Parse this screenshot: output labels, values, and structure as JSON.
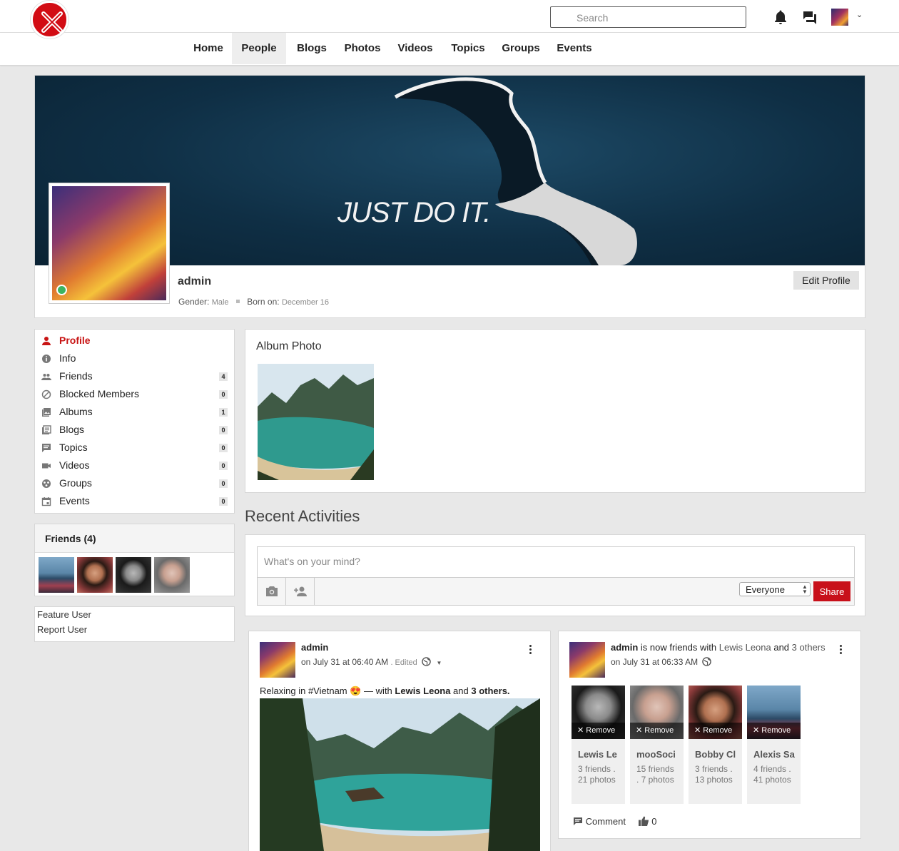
{
  "header": {
    "search_placeholder": "Search"
  },
  "nav": {
    "items": [
      {
        "label": "Home"
      },
      {
        "label": "People",
        "active": true
      },
      {
        "label": "Blogs"
      },
      {
        "label": "Photos"
      },
      {
        "label": "Videos"
      },
      {
        "label": "Topics"
      },
      {
        "label": "Groups"
      },
      {
        "label": "Events"
      }
    ]
  },
  "profile": {
    "cover_text": "JUST DO IT.",
    "name": "admin",
    "gender_label": "Gender:",
    "gender_value": "Male",
    "born_label": "Born on:",
    "born_value": "December 16",
    "edit_button": "Edit Profile",
    "online": true
  },
  "sidebar": {
    "items": [
      {
        "label": "Profile",
        "icon": "person-icon",
        "active": true
      },
      {
        "label": "Info",
        "icon": "info-icon",
        "count": ""
      },
      {
        "label": "Friends",
        "icon": "people-icon",
        "count": "4"
      },
      {
        "label": "Blocked Members",
        "icon": "block-icon",
        "count": "0"
      },
      {
        "label": "Albums",
        "icon": "photo-library-icon",
        "count": "1"
      },
      {
        "label": "Blogs",
        "icon": "blog-icon",
        "count": "0"
      },
      {
        "label": "Topics",
        "icon": "topic-icon",
        "count": "0"
      },
      {
        "label": "Videos",
        "icon": "video-icon",
        "count": "0"
      },
      {
        "label": "Groups",
        "icon": "group-icon",
        "count": "0"
      },
      {
        "label": "Events",
        "icon": "calendar-icon",
        "count": "0"
      }
    ]
  },
  "friends_widget": {
    "title": "Friends (4)"
  },
  "user_actions": {
    "feature": "Feature User",
    "report": "Report User"
  },
  "album": {
    "title": "Album Photo"
  },
  "recent": {
    "title": "Recent Activities"
  },
  "composer": {
    "placeholder": "What's on your mind?",
    "privacy": "Everyone",
    "share": "Share"
  },
  "posts": [
    {
      "author": "admin",
      "time": "on July 31 at 06:40 AM",
      "edited": ". Edited",
      "text_prefix": "Relaxing in ",
      "hashtag": "#Vietnam",
      "emoji": "😍",
      "with_text": " — with ",
      "with_name": "Lewis Leona",
      "and_text": " and ",
      "others_text": "3 others."
    },
    {
      "author": "admin",
      "action": " is now friends with ",
      "friend": "Lewis Leona",
      "and_text": " and ",
      "others_text": "3 others",
      "time": "on July 31 at 06:33 AM",
      "comment_label": "Comment",
      "like_count": "0",
      "friends": [
        {
          "name": "Lewis Le",
          "stats1": "3 friends .",
          "stats2": "21 photos",
          "remove": "Remove"
        },
        {
          "name": "mooSoci",
          "stats1": "15 friends",
          "stats2": ". 7 photos",
          "remove": "Remove"
        },
        {
          "name": "Bobby Cl",
          "stats1": "3 friends .",
          "stats2": "13 photos",
          "remove": "Remove"
        },
        {
          "name": "Alexis Sa",
          "stats1": "4 friends .",
          "stats2": "41 photos",
          "remove": "Remove"
        }
      ]
    }
  ],
  "colors": {
    "brand_red": "#c8101a",
    "online_green": "#3cb460"
  }
}
